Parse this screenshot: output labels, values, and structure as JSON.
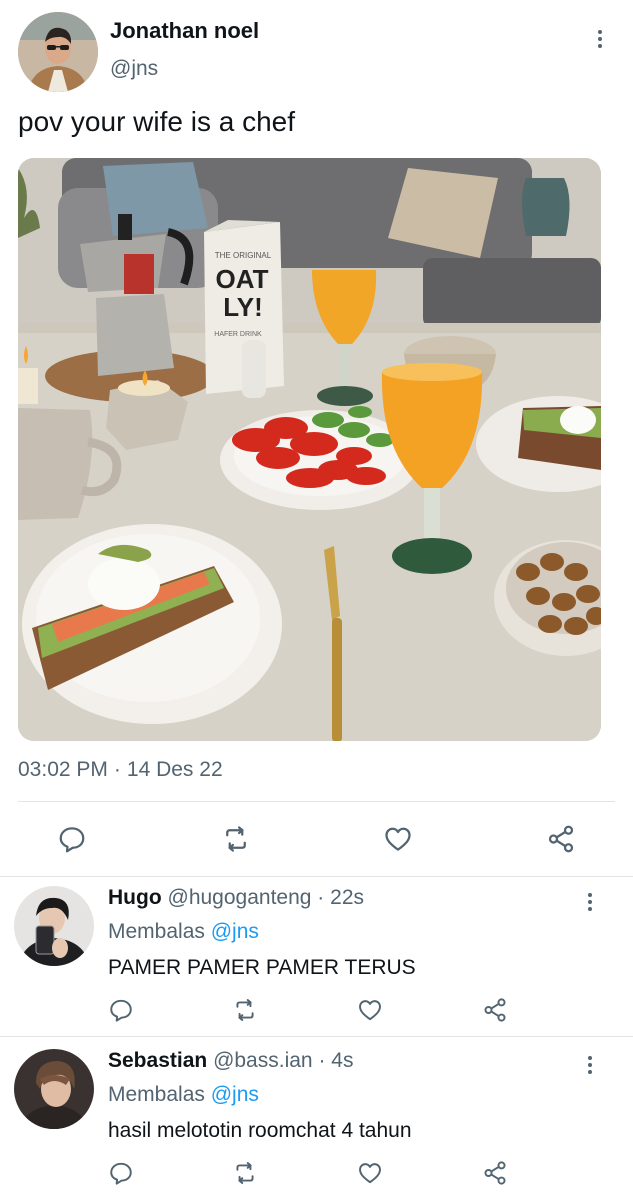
{
  "tweet": {
    "author_name": "Jonathan noel",
    "author_handle": "@jns",
    "text": "pov your wife is a chef",
    "time": "03:02 PM",
    "date": "14 Des 22",
    "date_separator": "·",
    "photo_packaging": {
      "brand_small": "THE ORIGINAL",
      "brand_big_1": "OAT",
      "brand_big_2": "LY!",
      "product": "HAFER DRINK"
    }
  },
  "icons": {
    "reply": "comment-icon",
    "retweet": "retweet-icon",
    "like": "heart-icon",
    "share": "share-icon",
    "more": "more-vertical-icon"
  },
  "replies": [
    {
      "name": "Hugo",
      "handle": "@hugoganteng",
      "separator": "·",
      "time": "22s",
      "replying_label": "Membalas",
      "replying_to": "@jns",
      "text": "PAMER PAMER PAMER TERUS"
    },
    {
      "name": "Sebastian",
      "handle": "@bass.ian",
      "separator": "·",
      "time": "4s",
      "replying_label": "Membalas",
      "replying_to": "@jns",
      "text": "hasil melototin roomchat 4 tahun"
    }
  ],
  "colors": {
    "text_primary": "#0f1419",
    "text_secondary": "#536471",
    "mention_blue": "#1d9bf0",
    "divider": "#e1e5e8"
  }
}
